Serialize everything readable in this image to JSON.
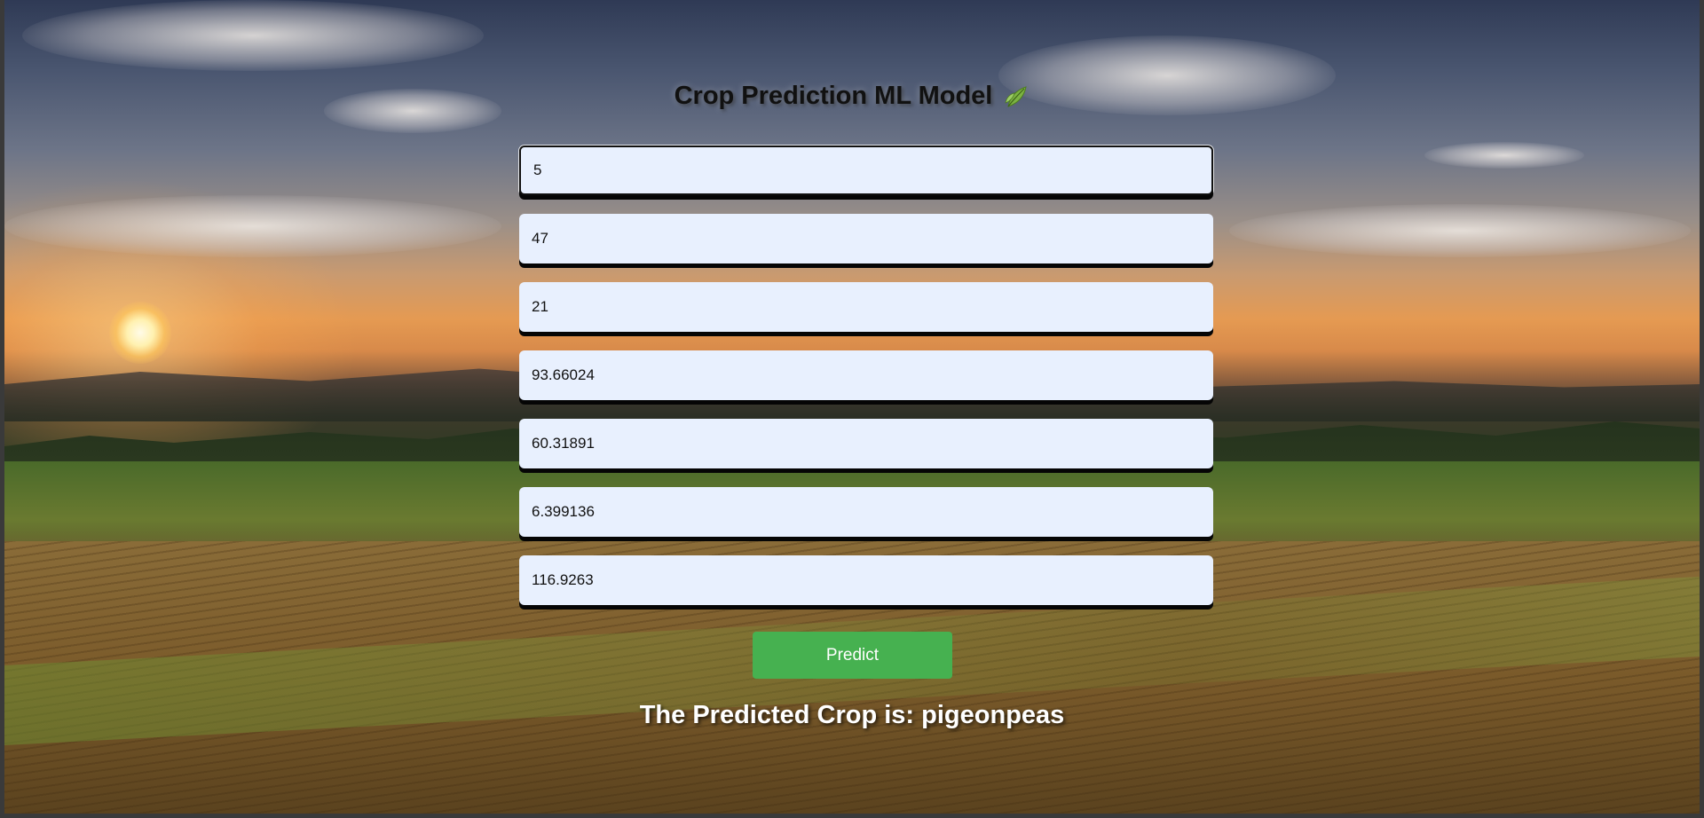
{
  "page": {
    "title": "Crop Prediction ML Model",
    "title_icon": "leaf-icon"
  },
  "form": {
    "fields": [
      {
        "value": "5"
      },
      {
        "value": "47"
      },
      {
        "value": "21"
      },
      {
        "value": "93.66024"
      },
      {
        "value": "60.31891"
      },
      {
        "value": "6.399136"
      },
      {
        "value": "116.9263"
      }
    ],
    "predict_label": "Predict"
  },
  "result": {
    "text": "The Predicted Crop is: pigeonpeas"
  },
  "colors": {
    "field_bg": "#e8f0fe",
    "button_bg": "#46b150",
    "result_text": "#ffffff"
  }
}
